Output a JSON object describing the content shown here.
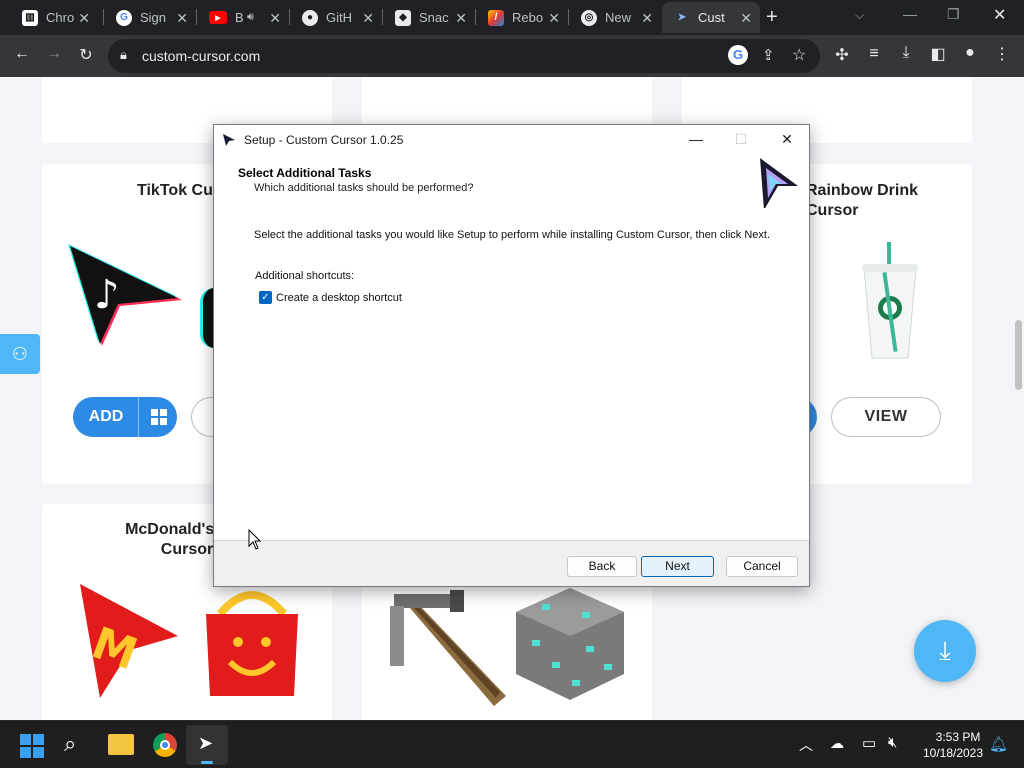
{
  "browser": {
    "tabs": [
      {
        "title": "Chro",
        "icon": "piano-icon"
      },
      {
        "title": "Sign",
        "icon": "google-icon"
      },
      {
        "title": "B",
        "icon": "youtube-icon"
      },
      {
        "title": "GitH",
        "icon": "github-icon"
      },
      {
        "title": "Snac",
        "icon": "snaccs-icon"
      },
      {
        "title": "Rebo",
        "icon": "rebooted-icon"
      },
      {
        "title": "New",
        "icon": "chrome-icon"
      },
      {
        "title": "Cust",
        "icon": "cursor-icon"
      }
    ],
    "new_tab": "+",
    "url": "custom-cursor.com"
  },
  "page": {
    "add_label": "ADD",
    "view_label": "VIEW",
    "cards": [
      {
        "title": "TikTok Cur"
      },
      {
        "title": "Rainbow Drink\nCursor"
      },
      {
        "title": "McDonald's Hap\nCursor"
      }
    ]
  },
  "dialog": {
    "title": "Setup - Custom Cursor 1.0.25",
    "heading": "Select Additional Tasks",
    "subheading": "Which additional tasks should be performed?",
    "instruction": "Select the additional tasks you would like Setup to perform while installing Custom Cursor, then click Next.",
    "shortcuts_label": "Additional shortcuts:",
    "checkbox_label": "Create a desktop shortcut",
    "checkbox_checked": true,
    "buttons": {
      "back": "Back",
      "next": "Next",
      "cancel": "Cancel"
    }
  },
  "taskbar": {
    "time": "3:53 PM",
    "date": "10/18/2023"
  },
  "colors": {
    "accent": "#2d8ae5",
    "dialog_accent": "#0067c0"
  }
}
